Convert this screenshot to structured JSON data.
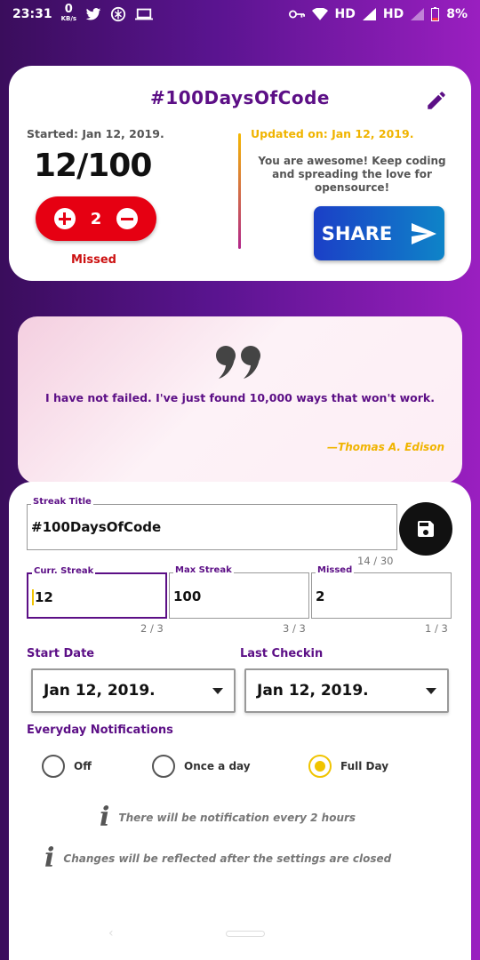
{
  "status_bar": {
    "time": "23:31",
    "net_speed": "0",
    "net_unit": "KB/s",
    "hd1": "HD",
    "hd2": "HD",
    "battery": "8%"
  },
  "streak_card": {
    "title": "#100DaysOfCode",
    "started": "Started: Jan 12, 2019.",
    "progress": "12/100",
    "missed_count": "2",
    "missed_label": "Missed",
    "updated": "Updated on: Jan 12, 2019.",
    "motivation": "You are awesome! Keep coding and spreading the love for opensource!",
    "share_label": "SHARE"
  },
  "quote": {
    "text": "I have not failed. I've just found 10,000 ways that won't work.",
    "author": "—Thomas A. Edison"
  },
  "form": {
    "title_label": "Streak Title",
    "title_value": "#100DaysOfCode",
    "title_counter": "14 / 30",
    "curr_label": "Curr. Streak",
    "curr_value": "12",
    "curr_counter": "2 / 3",
    "max_label": "Max Streak",
    "max_value": "100",
    "max_counter": "3 / 3",
    "missed_label": "Missed",
    "missed_value": "2",
    "missed_counter": "1 / 3",
    "start_date_label": "Start Date",
    "start_date_value": "Jan 12, 2019.",
    "last_checkin_label": "Last Checkin",
    "last_checkin_value": "Jan 12, 2019.",
    "notifications_label": "Everyday Notifications",
    "options": [
      "Off",
      "Once a day",
      "Full Day"
    ],
    "selected_option": "Full Day",
    "info1": "There will be notification every 2 hours",
    "info2": "Changes will be reflected after the settings are closed"
  },
  "colors": {
    "accent_purple": "#5c0f86",
    "accent_yellow": "#f0b400",
    "missed_red": "#e60012",
    "share_blue": "#1b3fc7"
  }
}
